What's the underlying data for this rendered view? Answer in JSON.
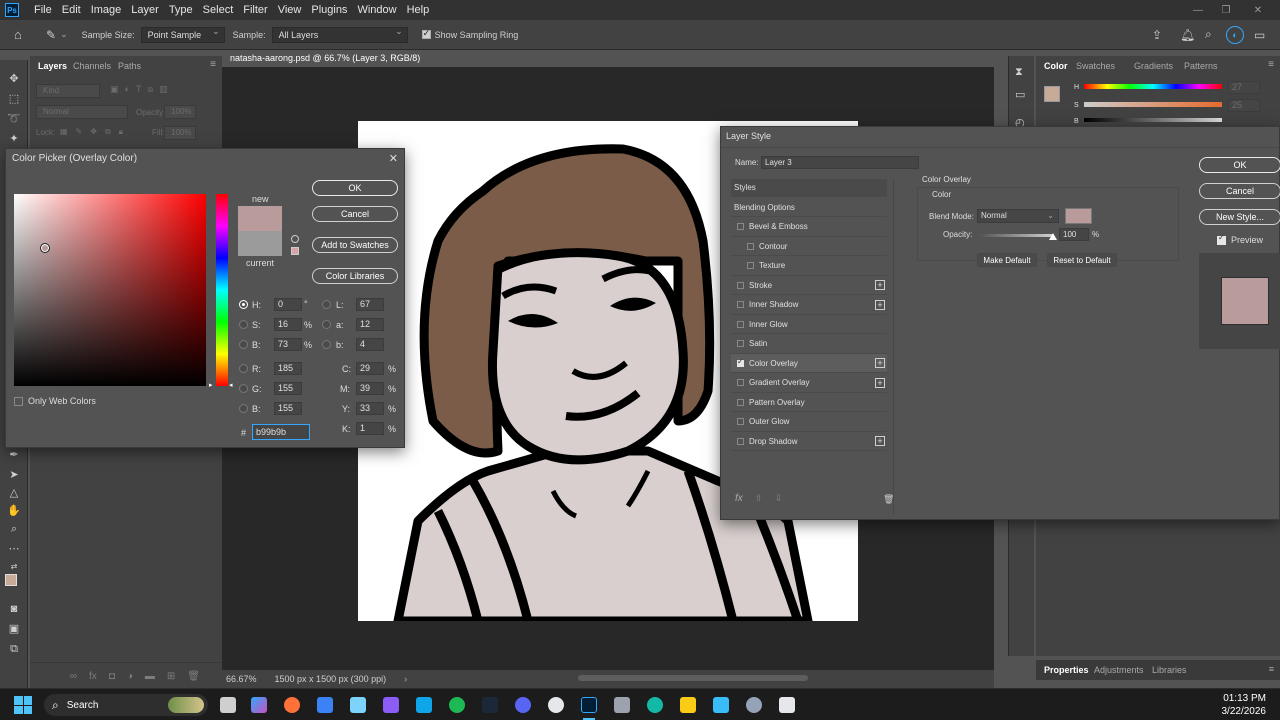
{
  "menu": {
    "logo": "Ps",
    "items": [
      "File",
      "Edit",
      "Image",
      "Layer",
      "Type",
      "Select",
      "Filter",
      "View",
      "Plugins",
      "Window",
      "Help"
    ]
  },
  "options": {
    "sample_size_label": "Sample Size:",
    "sample_size_value": "Point Sample",
    "sample_label": "Sample:",
    "sample_value": "All Layers",
    "sampling_ring_label": "Show Sampling Ring"
  },
  "layers_panel": {
    "tabs": [
      "Layers",
      "Channels",
      "Paths"
    ],
    "kind_placeholder": "Kind",
    "blend_mode": "Normal",
    "opacity_label": "Opacity:",
    "opacity_value": "100%",
    "lock_label": "Lock:",
    "fill_label": "Fill:",
    "fill_value": "100%"
  },
  "document": {
    "tab_title": "natasha-aarong.psd @ 66.7% (Layer 3, RGB/8) *",
    "zoom": "66.67%",
    "doc_size": "1500 px x 1500 px (300 ppi)"
  },
  "color_panel": {
    "tabs": [
      "Color",
      "Swatches",
      "Gradients",
      "Patterns"
    ],
    "sliders": [
      {
        "label": "H",
        "value": "27"
      },
      {
        "label": "S",
        "value": "25"
      },
      {
        "label": "B",
        "value": ""
      }
    ],
    "bottom_tabs": [
      "Properties",
      "Adjustments",
      "Libraries"
    ]
  },
  "color_picker": {
    "title": "Color Picker (Overlay Color)",
    "new_label": "new",
    "current_label": "current",
    "ok_label": "OK",
    "cancel_label": "Cancel",
    "add_swatches_label": "Add to Swatches",
    "color_libraries_label": "Color Libraries",
    "web_colors_label": "Only Web Colors",
    "new_color": "#b99b9b",
    "current_color": "#9b9b9b",
    "hsb": [
      {
        "label": "H:",
        "value": "0",
        "unit": "°"
      },
      {
        "label": "S:",
        "value": "16",
        "unit": "%"
      },
      {
        "label": "B:",
        "value": "73",
        "unit": "%"
      }
    ],
    "rgb": [
      {
        "label": "R:",
        "value": "185"
      },
      {
        "label": "G:",
        "value": "155"
      },
      {
        "label": "B:",
        "value": "155"
      }
    ],
    "lab": [
      {
        "label": "L:",
        "value": "67"
      },
      {
        "label": "a:",
        "value": "12"
      },
      {
        "label": "b:",
        "value": "4"
      }
    ],
    "cmyk": [
      {
        "label": "C:",
        "value": "29",
        "unit": "%"
      },
      {
        "label": "M:",
        "value": "39",
        "unit": "%"
      },
      {
        "label": "Y:",
        "value": "33",
        "unit": "%"
      },
      {
        "label": "K:",
        "value": "1",
        "unit": "%"
      }
    ],
    "hex_label": "#",
    "hex_value": "b99b9b"
  },
  "layer_style": {
    "title": "Layer Style",
    "name_label": "Name:",
    "name_value": "Layer 3",
    "styles_header": "Styles",
    "items": [
      {
        "label": "Blending Options",
        "check": false,
        "plus": false,
        "indent": false,
        "checkbox": false
      },
      {
        "label": "Bevel & Emboss",
        "check": false,
        "plus": false,
        "indent": false,
        "checkbox": true
      },
      {
        "label": "Contour",
        "check": false,
        "plus": false,
        "indent": true,
        "checkbox": true
      },
      {
        "label": "Texture",
        "check": false,
        "plus": false,
        "indent": true,
        "checkbox": true
      },
      {
        "label": "Stroke",
        "check": false,
        "plus": true,
        "indent": false,
        "checkbox": true
      },
      {
        "label": "Inner Shadow",
        "check": false,
        "plus": true,
        "indent": false,
        "checkbox": true
      },
      {
        "label": "Inner Glow",
        "check": false,
        "plus": false,
        "indent": false,
        "checkbox": true
      },
      {
        "label": "Satin",
        "check": false,
        "plus": false,
        "indent": false,
        "checkbox": true
      },
      {
        "label": "Color Overlay",
        "check": true,
        "plus": true,
        "indent": false,
        "checkbox": true
      },
      {
        "label": "Gradient Overlay",
        "check": false,
        "plus": true,
        "indent": false,
        "checkbox": true
      },
      {
        "label": "Pattern Overlay",
        "check": false,
        "plus": false,
        "indent": false,
        "checkbox": true
      },
      {
        "label": "Outer Glow",
        "check": false,
        "plus": false,
        "indent": false,
        "checkbox": true
      },
      {
        "label": "Drop Shadow",
        "check": false,
        "plus": true,
        "indent": false,
        "checkbox": true
      }
    ],
    "section_title": "Color Overlay",
    "section_sub": "Color",
    "blend_mode_label": "Blend Mode:",
    "blend_mode_value": "Normal",
    "overlay_color": "#b99b9b",
    "opacity_label": "Opacity:",
    "opacity_value": "100",
    "opacity_unit": "%",
    "opacity_fraction": 1.0,
    "make_default_label": "Make Default",
    "reset_default_label": "Reset to Default",
    "ok_label": "OK",
    "cancel_label": "Cancel",
    "new_style_label": "New Style...",
    "preview_label": "Preview",
    "fx_label": "fx"
  },
  "taskbar": {
    "search_label": "Search",
    "time": "01:13 PM",
    "date": "3/22/2026"
  },
  "colors": {
    "hair": "#7a5c48",
    "skin": "#d8cfce",
    "accent": "#31a8ff"
  }
}
